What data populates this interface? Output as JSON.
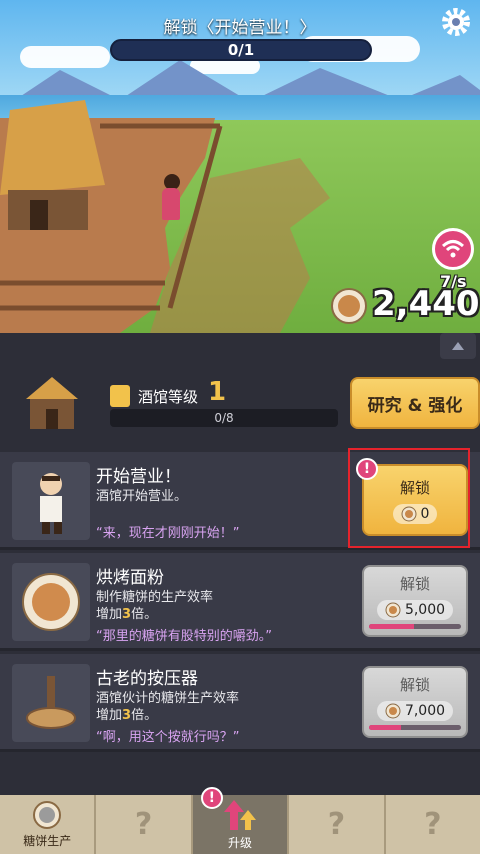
{
  "quest": {
    "title": "解锁〈开始营业！〉",
    "progress": "0/1"
  },
  "scene": {
    "rate": "7/s",
    "total": "2,440"
  },
  "tavern": {
    "level_label": "酒馆等级",
    "level": "1",
    "progress": "0/8",
    "research_button": "研究 & 强化"
  },
  "cards": [
    {
      "title": "开始营业！",
      "desc": "酒馆开始营业。",
      "quote": "“来，现在才刚刚开始！”",
      "button_label": "解锁",
      "price": "0",
      "state": "active",
      "alert": "!"
    },
    {
      "title": "烘烤面粉",
      "desc_line1": "制作糖饼的生产效率",
      "desc_line2_pre": "增加",
      "desc_line2_num": "3",
      "desc_line2_post": "倍。",
      "quote": "“那里的糖饼有股特别的嚼劲。”",
      "button_label": "解锁",
      "price": "5,000",
      "state": "locked",
      "cost_progress": 0.49
    },
    {
      "title": "古老的按压器",
      "desc_line1": "酒馆伙计的糖饼生产效率",
      "desc_line2_pre": "增加",
      "desc_line2_num": "3",
      "desc_line2_post": "倍。",
      "quote": "“啊，用这个按就行吗？”",
      "button_label": "解锁",
      "price": "7,000",
      "state": "locked",
      "cost_progress": 0.35
    }
  ],
  "nav": {
    "tabs": [
      {
        "label": "糖饼生产",
        "icon": "coin-icon"
      },
      {
        "label": "?",
        "icon": "unknown-icon"
      },
      {
        "label": "升级",
        "icon": "upgrade-arrows-icon",
        "alert": "!"
      },
      {
        "label": "?",
        "icon": "unknown-icon"
      },
      {
        "label": "?",
        "icon": "unknown-icon"
      }
    ]
  },
  "colors": {
    "accent": "#f2c24b",
    "alert": "#e0457b",
    "highlight": "#e5232c",
    "quote": "#d9a4f2"
  }
}
